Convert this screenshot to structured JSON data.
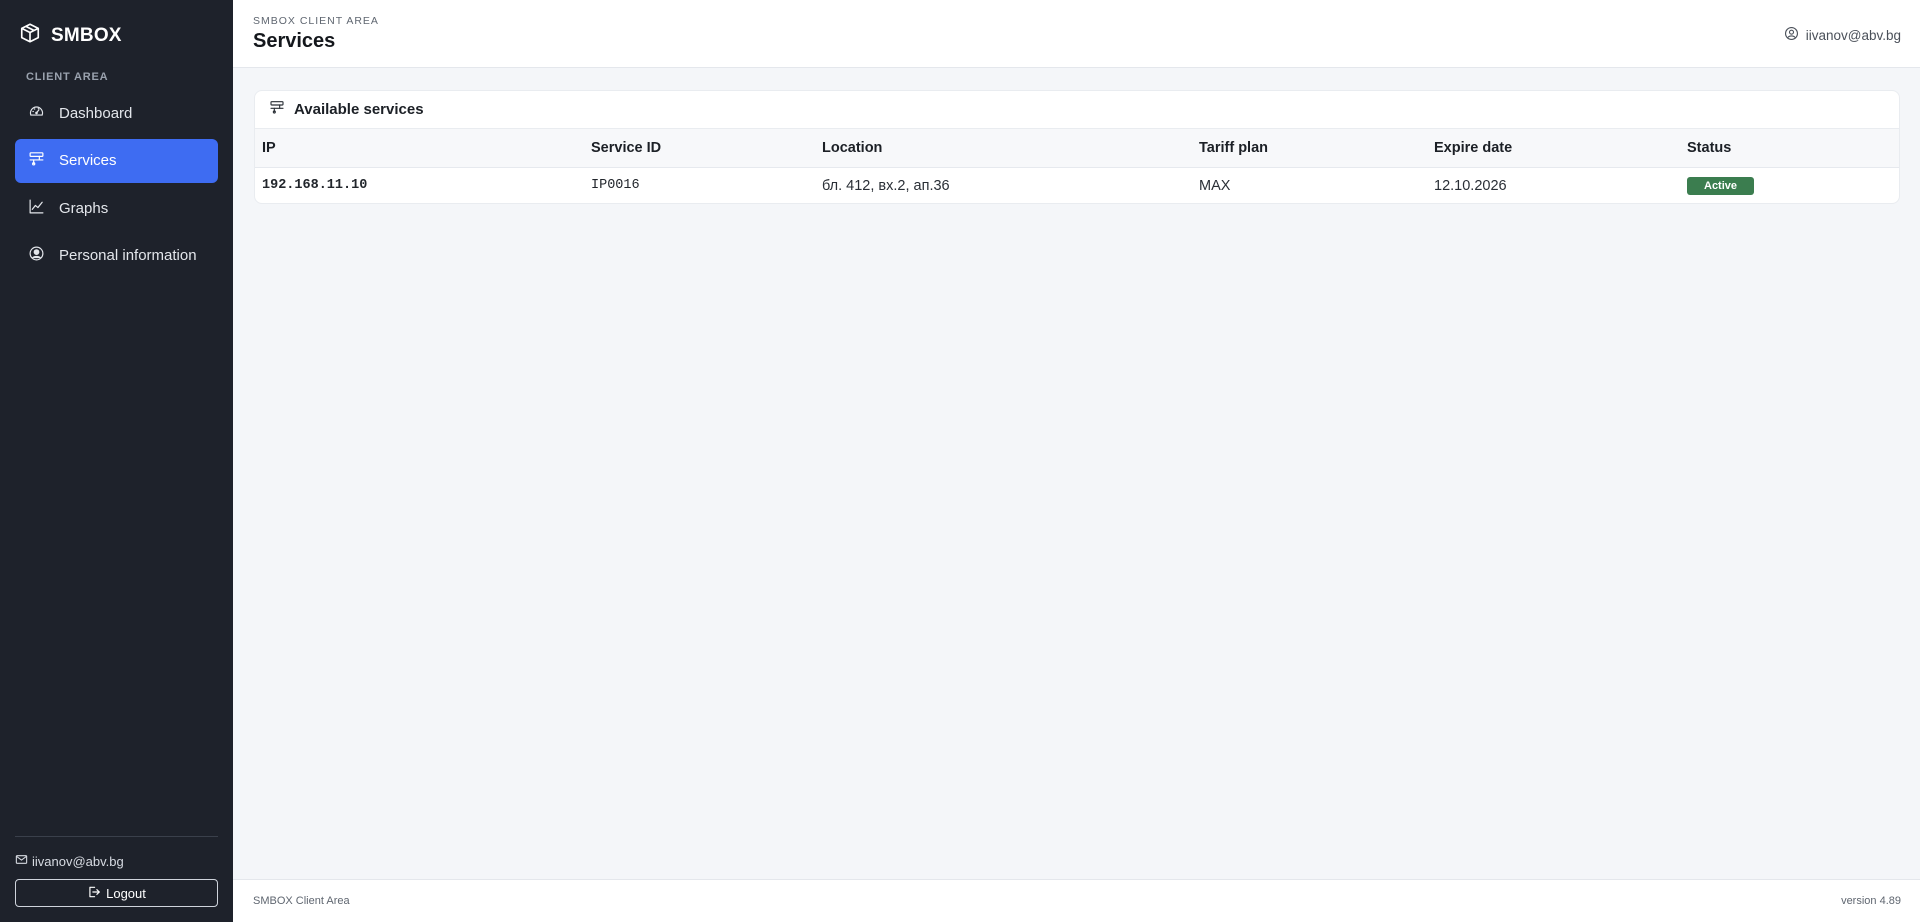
{
  "sidebar": {
    "brand": {
      "name": "SMBOX",
      "icon": "cube-icon"
    },
    "section_label": "CLIENT AREA",
    "items": [
      {
        "label": "Dashboard",
        "icon": "speedometer-icon",
        "active": false
      },
      {
        "label": "Services",
        "icon": "sliders-icon",
        "active": true
      },
      {
        "label": "Graphs",
        "icon": "line-chart-icon",
        "active": false
      },
      {
        "label": "Personal information",
        "icon": "user-circle-icon",
        "active": false
      }
    ],
    "email": "iivanov@abv.bg",
    "logout_label": "Logout"
  },
  "header": {
    "kicker": "SMBOX CLIENT AREA",
    "title": "Services",
    "user_email": "iivanov@abv.bg"
  },
  "services_card": {
    "title": "Available services",
    "columns": [
      "IP",
      "Service ID",
      "Location",
      "Tariff plan",
      "Expire date",
      "Status"
    ],
    "rows": [
      {
        "ip": "192.168.11.10",
        "service_id": "IP0016",
        "location": "бл. 412, вх.2, ап.36",
        "tariff_plan": "MAX",
        "expire_date": "12.10.2026",
        "status": "Active"
      }
    ]
  },
  "footer": {
    "left": "SMBOX Client Area",
    "right": "version 4.89"
  },
  "colors": {
    "sidebar_bg": "#1e222b",
    "accent": "#3e6cf2",
    "status_active": "#3b7d4f"
  }
}
